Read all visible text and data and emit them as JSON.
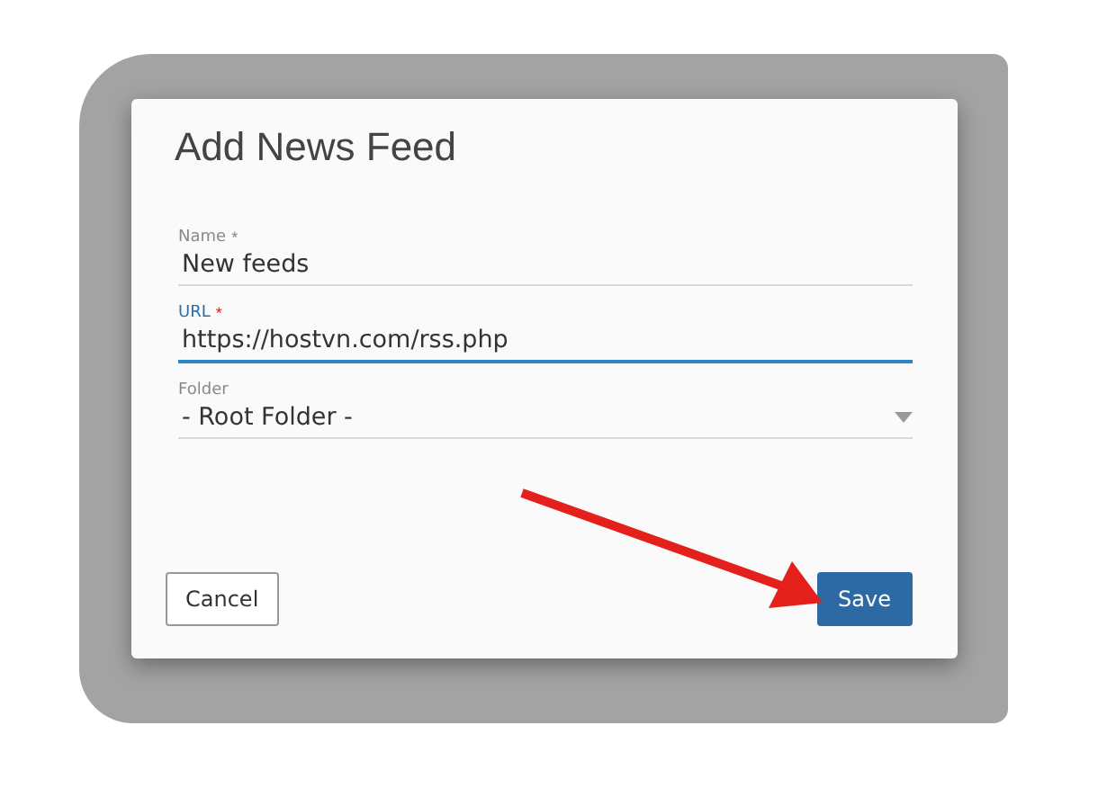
{
  "dialog": {
    "title": "Add News Feed",
    "fields": [
      {
        "kind": "text",
        "label": "Name",
        "required": "*",
        "value": "New feeds",
        "focused": false
      },
      {
        "kind": "text",
        "label": "URL",
        "required": "*",
        "value": "https://hostvn.com/rss.php",
        "focused": true
      },
      {
        "kind": "select",
        "label": "Folder",
        "value": "- Root Folder -",
        "focused": false
      }
    ],
    "buttons": [
      {
        "label": "Cancel",
        "kind": "secondary"
      },
      {
        "label": "Save",
        "kind": "primary"
      }
    ]
  },
  "annotation": {
    "kind": "arrow"
  }
}
